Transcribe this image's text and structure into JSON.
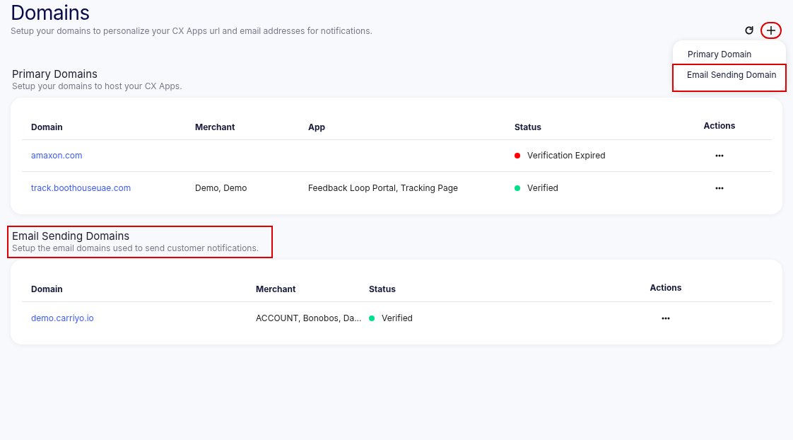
{
  "page": {
    "title": "Domains",
    "subtitle": "Setup your domains to personalize your CX Apps url and email addresses for notifications."
  },
  "toolbar": {
    "add_highlighted": true
  },
  "add_menu": {
    "open": true,
    "items": [
      {
        "label": "Primary Domain",
        "highlighted": false
      },
      {
        "label": "Email Sending Domain",
        "highlighted": true
      }
    ]
  },
  "sections": [
    {
      "title": "Primary Domains",
      "subtitle": "Setup your domains to host your CX Apps.",
      "columns": [
        "Domain",
        "Merchant",
        "App",
        "Status",
        "Actions"
      ],
      "rows": [
        {
          "domain": "amaxon.com",
          "merchant": "",
          "app": "",
          "status": "Verification Expired",
          "color": "#ff0000"
        },
        {
          "domain": "track.boothouseuae.com",
          "merchant": "Demo, Demo",
          "app": "Feedback Loop Portal, Tracking Page",
          "status": "Verified",
          "color": "#00e08a"
        }
      ]
    },
    {
      "title": "Email Sending Domains",
      "subtitle": "Setup the email domains used to send customer notifications.",
      "highlighted": true,
      "columns": [
        "Domain",
        "Merchant",
        "Status",
        "Actions"
      ],
      "rows": [
        {
          "domain": "demo.carriyo.io",
          "merchant": "ACCOUNT, Bonobos, Da...",
          "status": "Verified",
          "color": "#00e08a"
        }
      ]
    }
  ]
}
